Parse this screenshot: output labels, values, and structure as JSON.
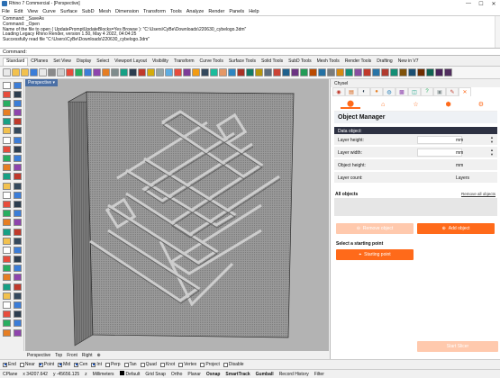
{
  "window": {
    "title": "Rhino 7 Commercial - [Perspective]",
    "controls": [
      "—",
      "☐",
      "✕"
    ]
  },
  "menu": [
    "File",
    "Edit",
    "View",
    "Curve",
    "Surface",
    "SubD",
    "Mesh",
    "Dimension",
    "Transform",
    "Tools",
    "Analyze",
    "Render",
    "Panels",
    "Help"
  ],
  "history": [
    "Command: _SaveAs",
    "Command: _Open",
    "Name of the file to open ( UpdatePromptUpdateBlocks=Yes  Browse ): \"C:\\Users\\CyBe\\Downloads\\220630_cybelogo.3dm\"",
    "Loading Legacy Rhino Render, version 1.50, May  4 2022, 04:04:25",
    "Successfully read file \"C:\\Users\\CyBe\\Downloads\\220630_cybelogo.3dm\""
  ],
  "command": {
    "label": "Command:",
    "value": ""
  },
  "toolbar_tabs": [
    "Standard",
    "CPlanes",
    "Set View",
    "Display",
    "Select",
    "Viewport Layout",
    "Visibility",
    "Transform",
    "Curve Tools",
    "Surface Tools",
    "Solid Tools",
    "SubD Tools",
    "Mesh Tools",
    "Render Tools",
    "Drafting",
    "New in V7"
  ],
  "toolbar_active": "Standard",
  "viewport": {
    "name": "Perspective ▾"
  },
  "viewport_tabs": [
    "Perspective",
    "Top",
    "Front",
    "Right",
    "⊕"
  ],
  "osnaps": [
    {
      "label": "End",
      "on": true
    },
    {
      "label": "Near",
      "on": false
    },
    {
      "label": "Point",
      "on": true
    },
    {
      "label": "Mid",
      "on": true
    },
    {
      "label": "Cen",
      "on": true
    },
    {
      "label": "Int",
      "on": true
    },
    {
      "label": "Perp",
      "on": false
    },
    {
      "label": "Tan",
      "on": false
    },
    {
      "label": "Quad",
      "on": false
    },
    {
      "label": "Knot",
      "on": false
    },
    {
      "label": "Vertex",
      "on": false
    },
    {
      "label": "Project",
      "on": false
    },
    {
      "label": "Disable",
      "on": false
    }
  ],
  "status": {
    "cplane": "CPlane",
    "x": "x 34207.642",
    "y": "y -45656.125",
    "z": "z",
    "units": "Millimeters",
    "layer": "Default",
    "items": [
      "Grid Snap",
      "Ortho",
      "Planar",
      "Osnap",
      "SmartTrack",
      "Gumball",
      "Record History",
      "Filter"
    ]
  },
  "panel": {
    "header": "Chysel",
    "plugin_tabs": [
      "⬤",
      "⌂",
      "☆",
      "⬢",
      "⚙"
    ],
    "title": "Object Manager",
    "data_object": "Data object:",
    "rows": [
      {
        "label": "Layer height:",
        "value": "",
        "unit": "mm",
        "editable": true
      },
      {
        "label": "Layer width:",
        "value": "",
        "unit": "mm",
        "editable": true
      },
      {
        "label": "Object height:",
        "value": "",
        "unit": "mm",
        "editable": false
      },
      {
        "label": "Layer count:",
        "value": "",
        "unit": "Layers",
        "editable": false
      }
    ],
    "all_objects": "All objects",
    "remove_all": "Remove all objects",
    "remove_btn": "Remove object",
    "add_btn": "Add object",
    "starting_point_label": "Select a starting point",
    "starting_point_btn": "Starting point",
    "big_btn": "Start Slicer"
  }
}
